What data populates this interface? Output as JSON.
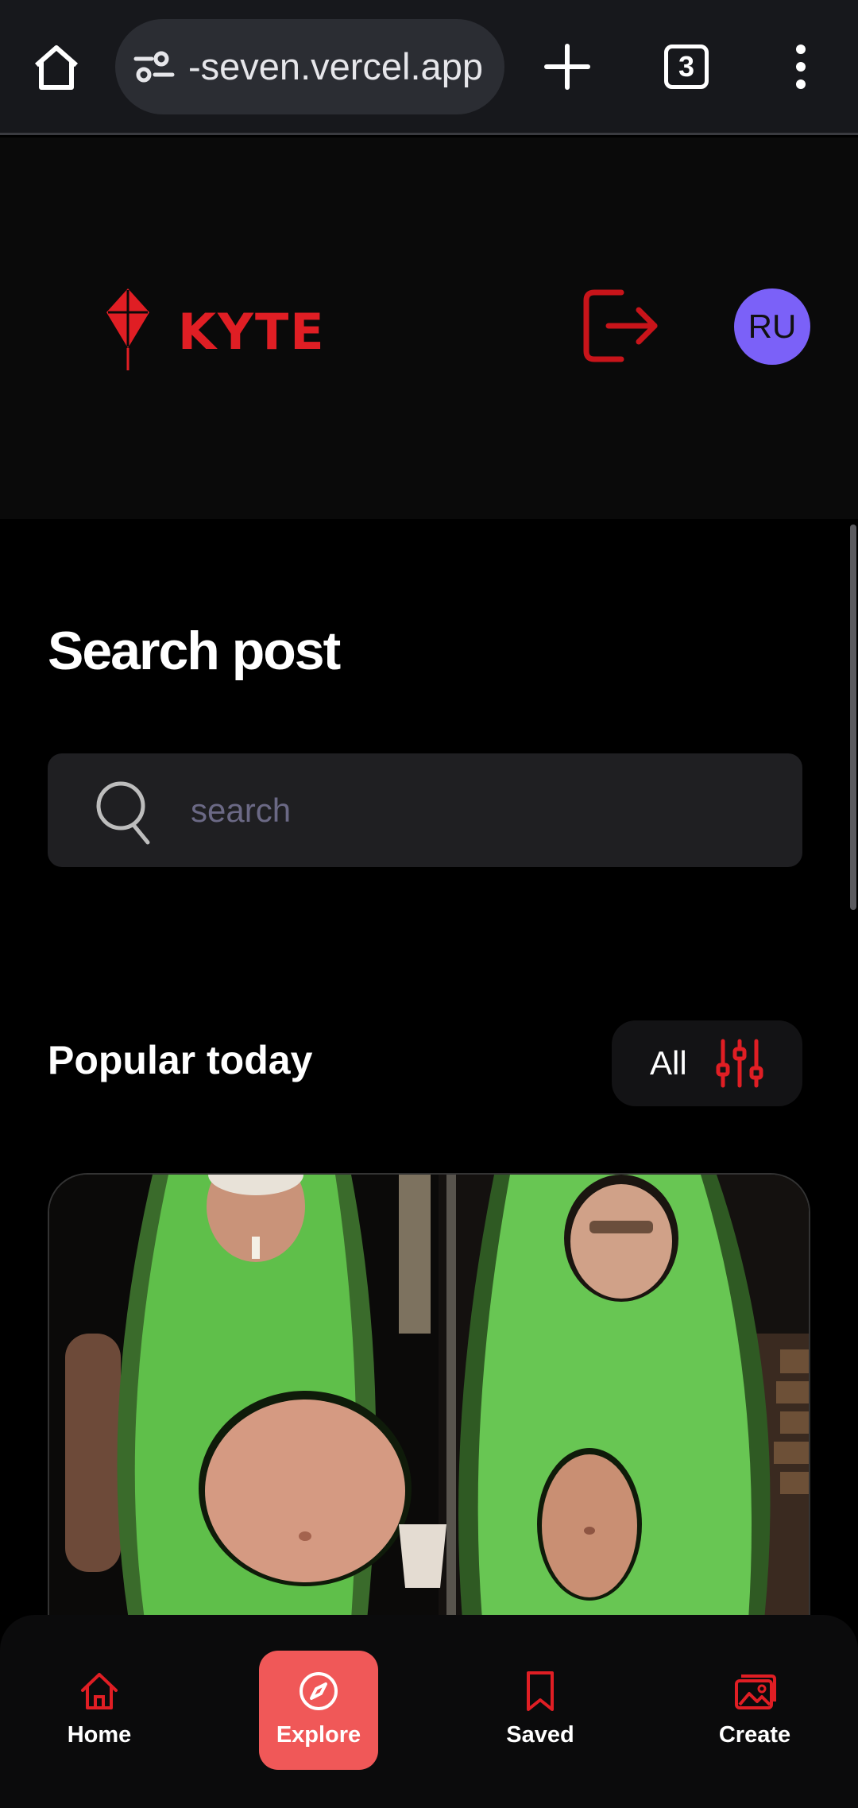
{
  "browser": {
    "url": "-seven.vercel.app",
    "tab_count": "3"
  },
  "header": {
    "logo_text": "KYTE",
    "avatar_initials": "RU"
  },
  "main": {
    "title": "Search post",
    "search": {
      "placeholder": "search",
      "value": ""
    },
    "section_title": "Popular today",
    "filter_label": "All"
  },
  "nav": {
    "items": [
      {
        "label": "Home",
        "icon": "home-icon",
        "active": false
      },
      {
        "label": "Explore",
        "icon": "compass-icon",
        "active": true
      },
      {
        "label": "Saved",
        "icon": "bookmark-icon",
        "active": false
      },
      {
        "label": "Create",
        "icon": "gallery-icon",
        "active": false
      }
    ]
  },
  "colors": {
    "accent": "#e01e24",
    "active_nav": "#f05858",
    "avatar": "#7b61f8",
    "background": "#000000"
  }
}
